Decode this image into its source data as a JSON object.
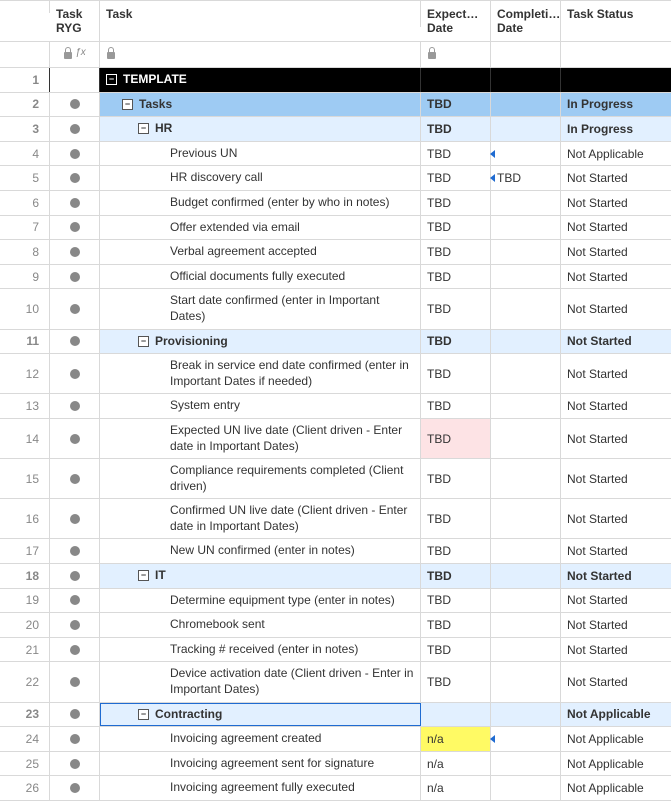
{
  "columns": {
    "num": "",
    "ryg": "Task RYG",
    "task": "Task",
    "date1": "Expect… Date",
    "date2": "Completi… Date",
    "status": "Task Status"
  },
  "icons": {
    "lock": "lock-icon",
    "fx": "ƒx",
    "toggle_minus": "−"
  },
  "rows": [
    {
      "num": "1",
      "ryg": false,
      "indent": 0,
      "toggle": true,
      "task": "TEMPLATE",
      "date1": "",
      "date2": "",
      "status": "",
      "style": "black",
      "taskBold": true
    },
    {
      "num": "2",
      "ryg": true,
      "indent": 1,
      "toggle": true,
      "task": "Tasks",
      "date1": "TBD",
      "date2": "",
      "status": "In Progress",
      "style": "blue-dark",
      "taskBold": true
    },
    {
      "num": "3",
      "ryg": true,
      "indent": 2,
      "toggle": true,
      "task": "HR",
      "date1": "TBD",
      "date2": "",
      "status": "In Progress",
      "style": "blue-light",
      "taskBold": true
    },
    {
      "num": "4",
      "ryg": true,
      "indent": 3,
      "toggle": false,
      "task": "Previous UN",
      "date1": "TBD",
      "date2": "",
      "status": "Not Applicable",
      "style": "",
      "arrow": true
    },
    {
      "num": "5",
      "ryg": true,
      "indent": 3,
      "toggle": false,
      "task": "HR discovery call",
      "date1": "TBD",
      "date2": "TBD",
      "status": "Not Started",
      "style": "",
      "arrow": true
    },
    {
      "num": "6",
      "ryg": true,
      "indent": 3,
      "toggle": false,
      "task": "Budget confirmed (enter by who in notes)",
      "date1": "TBD",
      "date2": "",
      "status": "Not Started",
      "style": ""
    },
    {
      "num": "7",
      "ryg": true,
      "indent": 3,
      "toggle": false,
      "task": "Offer extended via email",
      "date1": "TBD",
      "date2": "",
      "status": "Not Started",
      "style": ""
    },
    {
      "num": "8",
      "ryg": true,
      "indent": 3,
      "toggle": false,
      "task": "Verbal agreement accepted",
      "date1": "TBD",
      "date2": "",
      "status": "Not Started",
      "style": ""
    },
    {
      "num": "9",
      "ryg": true,
      "indent": 3,
      "toggle": false,
      "task": "Official documents fully executed",
      "date1": "TBD",
      "date2": "",
      "status": "Not Started",
      "style": ""
    },
    {
      "num": "10",
      "ryg": true,
      "indent": 3,
      "toggle": false,
      "task": "Start date confirmed (enter in Important Dates)",
      "date1": "TBD",
      "date2": "",
      "status": "Not Started",
      "style": ""
    },
    {
      "num": "11",
      "ryg": true,
      "indent": 2,
      "toggle": true,
      "task": "Provisioning",
      "date1": "TBD",
      "date2": "",
      "status": "Not Started",
      "style": "blue-light",
      "taskBold": true
    },
    {
      "num": "12",
      "ryg": true,
      "indent": 3,
      "toggle": false,
      "task": "Break in service end date confirmed (enter in Important Dates if needed)",
      "date1": "TBD",
      "date2": "",
      "status": "Not Started",
      "style": ""
    },
    {
      "num": "13",
      "ryg": true,
      "indent": 3,
      "toggle": false,
      "task": "System entry",
      "date1": "TBD",
      "date2": "",
      "status": "Not Started",
      "style": ""
    },
    {
      "num": "14",
      "ryg": true,
      "indent": 3,
      "toggle": false,
      "task": "Expected UN live date (Client driven - Enter date in Important Dates)",
      "date1": "TBD",
      "date2": "",
      "status": "Not Started",
      "style": "",
      "date1Highlight": "pink"
    },
    {
      "num": "15",
      "ryg": true,
      "indent": 3,
      "toggle": false,
      "task": "Compliance requirements completed (Client driven)",
      "date1": "TBD",
      "date2": "",
      "status": "Not Started",
      "style": ""
    },
    {
      "num": "16",
      "ryg": true,
      "indent": 3,
      "toggle": false,
      "task": "Confirmed UN live date (Client driven - Enter date in Important Dates)",
      "date1": "TBD",
      "date2": "",
      "status": "Not Started",
      "style": ""
    },
    {
      "num": "17",
      "ryg": true,
      "indent": 3,
      "toggle": false,
      "task": "New UN confirmed (enter in notes)",
      "date1": "TBD",
      "date2": "",
      "status": "Not Started",
      "style": ""
    },
    {
      "num": "18",
      "ryg": true,
      "indent": 2,
      "toggle": true,
      "task": "IT",
      "date1": "TBD",
      "date2": "",
      "status": "Not Started",
      "style": "blue-light",
      "taskBold": true
    },
    {
      "num": "19",
      "ryg": true,
      "indent": 3,
      "toggle": false,
      "task": "Determine equipment type (enter in notes)",
      "date1": "TBD",
      "date2": "",
      "status": "Not Started",
      "style": ""
    },
    {
      "num": "20",
      "ryg": true,
      "indent": 3,
      "toggle": false,
      "task": "Chromebook sent",
      "date1": "TBD",
      "date2": "",
      "status": "Not Started",
      "style": ""
    },
    {
      "num": "21",
      "ryg": true,
      "indent": 3,
      "toggle": false,
      "task": "Tracking # received (enter in notes)",
      "date1": "TBD",
      "date2": "",
      "status": "Not Started",
      "style": ""
    },
    {
      "num": "22",
      "ryg": true,
      "indent": 3,
      "toggle": false,
      "task": "Device activation date (Client driven - Enter in Important Dates)",
      "date1": "TBD",
      "date2": "",
      "status": "Not Started",
      "style": ""
    },
    {
      "num": "23",
      "ryg": true,
      "indent": 2,
      "toggle": true,
      "task": "Contracting",
      "date1": "",
      "date2": "",
      "status": "Not Applicable",
      "style": "blue-light",
      "taskBold": true,
      "selected": true
    },
    {
      "num": "24",
      "ryg": true,
      "indent": 3,
      "toggle": false,
      "task": "Invoicing agreement created",
      "date1": "n/a",
      "date2": "",
      "status": "Not Applicable",
      "style": "",
      "date1Highlight": "yellow",
      "arrow": true
    },
    {
      "num": "25",
      "ryg": true,
      "indent": 3,
      "toggle": false,
      "task": "Invoicing agreement sent for signature",
      "date1": "n/a",
      "date2": "",
      "status": "Not Applicable",
      "style": ""
    },
    {
      "num": "26",
      "ryg": true,
      "indent": 3,
      "toggle": false,
      "task": "Invoicing agreement fully executed",
      "date1": "n/a",
      "date2": "",
      "status": "Not Applicable",
      "style": ""
    }
  ]
}
